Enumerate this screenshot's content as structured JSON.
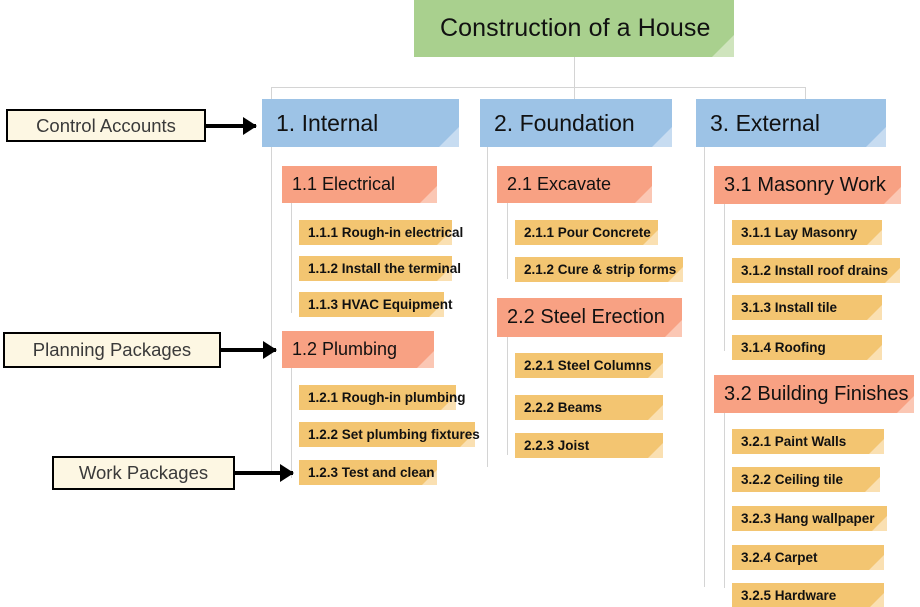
{
  "diagram": {
    "title": "Construction of a House",
    "annotations": [
      {
        "label": "Control Accounts"
      },
      {
        "label": "Planning Packages"
      },
      {
        "label": "Work Packages"
      }
    ],
    "branches": [
      {
        "label": "1. Internal",
        "packages": [
          {
            "label": "1.1 Electrical",
            "tasks": [
              {
                "label": "1.1.1 Rough-in electrical"
              },
              {
                "label": "1.1.2 Install the terminal"
              },
              {
                "label": "1.1.3 HVAC Equipment"
              }
            ]
          },
          {
            "label": "1.2 Plumbing",
            "tasks": [
              {
                "label": "1.2.1 Rough-in plumbing"
              },
              {
                "label": "1.2.2 Set plumbing fixtures"
              },
              {
                "label": "1.2.3 Test and clean"
              }
            ]
          }
        ]
      },
      {
        "label": "2. Foundation",
        "packages": [
          {
            "label": "2.1 Excavate",
            "tasks": [
              {
                "label": "2.1.1 Pour Concrete"
              },
              {
                "label": "2.1.2 Cure & strip forms"
              }
            ]
          },
          {
            "label": "2.2 Steel Erection",
            "tasks": [
              {
                "label": "2.2.1 Steel Columns"
              },
              {
                "label": "2.2.2 Beams"
              },
              {
                "label": "2.2.3 Joist"
              }
            ]
          }
        ]
      },
      {
        "label": "3. External",
        "packages": [
          {
            "label": "3.1 Masonry Work",
            "tasks": [
              {
                "label": "3.1.1 Lay Masonry"
              },
              {
                "label": "3.1.2 Install roof drains"
              },
              {
                "label": "3.1.3 Install tile"
              },
              {
                "label": "3.1.4 Roofing"
              }
            ]
          },
          {
            "label": "3.2 Building Finishes",
            "tasks": [
              {
                "label": "3.2.1 Paint Walls"
              },
              {
                "label": "3.2.2 Ceiling tile"
              },
              {
                "label": "3.2.3 Hang wallpaper"
              },
              {
                "label": "3.2.4 Carpet"
              },
              {
                "label": "3.2.5 Hardware"
              }
            ]
          }
        ]
      }
    ],
    "colors": {
      "title_fill": "#a9d08e",
      "control_account_fill": "#9dc3e6",
      "planning_package_fill": "#f8a183",
      "work_package_fill": "#f3c571",
      "callout_fill": "#fdf7e3",
      "connector": "#d4d4d4"
    }
  }
}
